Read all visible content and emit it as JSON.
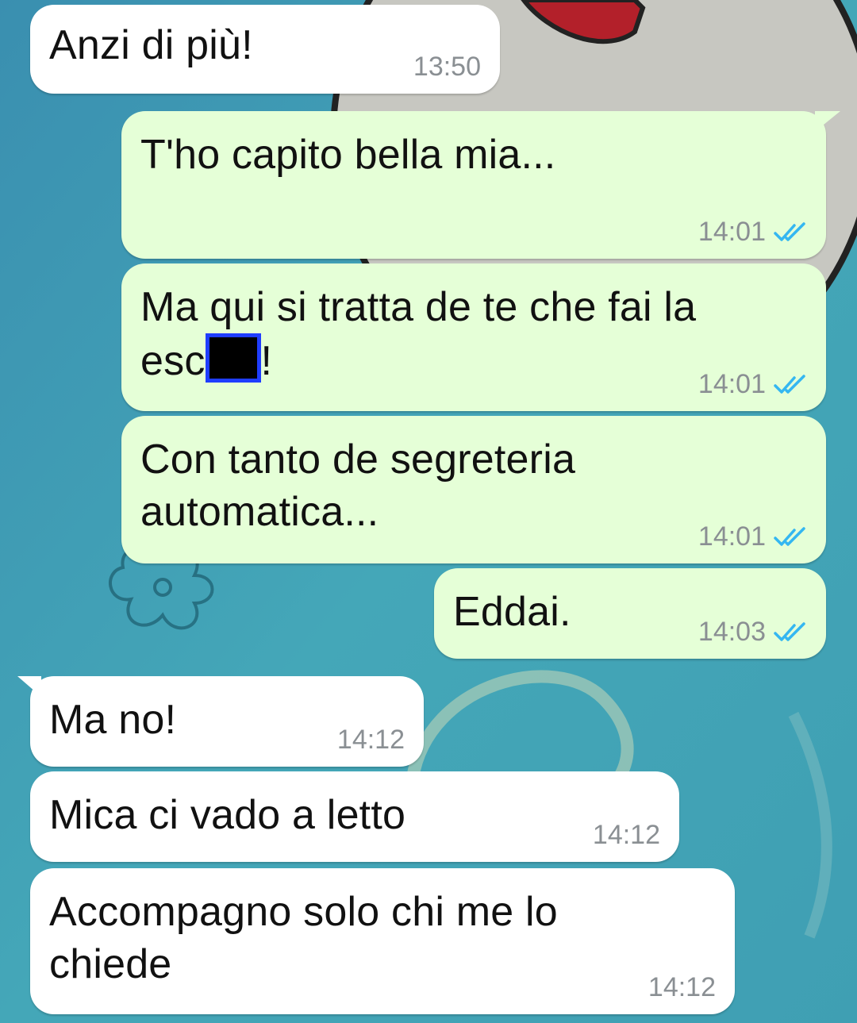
{
  "messages": [
    {
      "text": "Anzi di più!",
      "time": "13:50"
    },
    {
      "text": "T'ho capito bella mia...",
      "time": "14:01",
      "status": "read"
    },
    {
      "line1": "Ma qui si tratta de te che fai la",
      "line2_start": "esc",
      "line2_end": "!",
      "time": "14:01",
      "status": "read"
    },
    {
      "line1": "Con tanto de segreteria",
      "line2": "automatica...",
      "time": "14:01",
      "status": "read"
    },
    {
      "text": "Eddai.",
      "time": "14:03",
      "status": "read"
    },
    {
      "text": "Ma no!",
      "time": "14:12"
    },
    {
      "text": "Mica ci vado a letto",
      "time": "14:12"
    },
    {
      "line1": "Accompagno solo chi me lo",
      "line2": "chiede",
      "time": "14:12"
    }
  ],
  "colors": {
    "incoming_bubble": "#ffffff",
    "outgoing_bubble": "#e5ffd7",
    "read_ticks": "#34b7f1",
    "timestamp": "#8a8f93",
    "redaction_border": "#1f3dff"
  },
  "icons": {
    "read_receipt": "double-check-icon",
    "wallpaper_flower": "flower-icon"
  }
}
